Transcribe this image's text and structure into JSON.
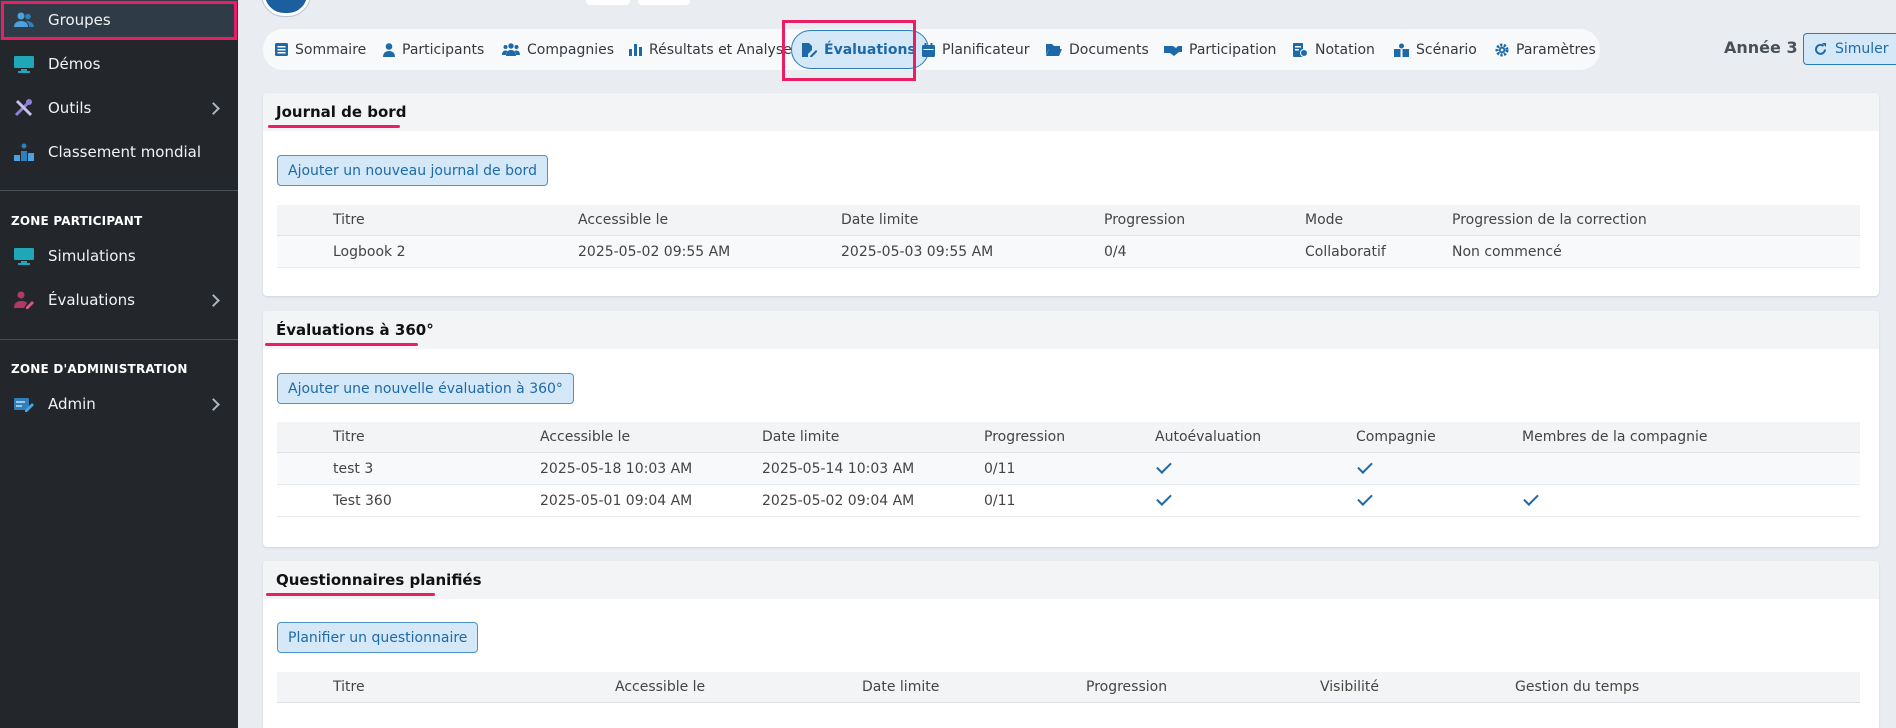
{
  "sidebar": {
    "items": [
      {
        "label": "Groupes"
      },
      {
        "label": "Démos"
      },
      {
        "label": "Outils"
      },
      {
        "label": "Classement mondial"
      },
      {
        "label": "Simulations"
      },
      {
        "label": "Évaluations"
      },
      {
        "label": "Admin"
      }
    ],
    "sections": {
      "participant": "ZONE PARTICIPANT",
      "admin": "ZONE D'ADMINISTRATION"
    }
  },
  "nav": {
    "tabs": [
      {
        "label": "Sommaire",
        "icon": "list-icon"
      },
      {
        "label": "Participants",
        "icon": "user-icon"
      },
      {
        "label": "Compagnies",
        "icon": "users-icon"
      },
      {
        "label": "Résultats et Analyse",
        "icon": "bar-chart-icon"
      },
      {
        "label": "Évaluations",
        "icon": "file-pen-icon"
      },
      {
        "label": "Planificateur",
        "icon": "calendar-icon"
      },
      {
        "label": "Documents",
        "icon": "folder-icon"
      },
      {
        "label": "Participation",
        "icon": "handshake-icon"
      },
      {
        "label": "Notation",
        "icon": "grading-icon"
      },
      {
        "label": "Scénario",
        "icon": "scenario-icon"
      },
      {
        "label": "Paramètres",
        "icon": "gear-icon"
      }
    ],
    "active": "Évaluations",
    "year": "Année 3",
    "simulate_label": "Simuler"
  },
  "logbook": {
    "title": "Journal de bord",
    "add_label": "Ajouter un nouveau journal de bord",
    "columns": [
      "Titre",
      "Accessible le",
      "Date limite",
      "Progression",
      "Mode",
      "Progression de la correction"
    ],
    "rows": [
      [
        "Logbook 2",
        "2025-05-02 09:55 AM",
        "2025-05-03 09:55 AM",
        "0/4",
        "Collaboratif",
        "Non commencé"
      ]
    ]
  },
  "eval360": {
    "title": "Évaluations à 360°",
    "add_label": "Ajouter une nouvelle évaluation à 360°",
    "columns": [
      "Titre",
      "Accessible le",
      "Date limite",
      "Progression",
      "Autoévaluation",
      "Compagnie",
      "Membres de la compagnie"
    ],
    "rows": [
      {
        "title": "test 3",
        "access": "2025-05-18 10:03 AM",
        "deadline": "2025-05-14 10:03 AM",
        "progress": "0/11",
        "self": true,
        "company": true,
        "members": false
      },
      {
        "title": "Test 360",
        "access": "2025-05-01 09:04 AM",
        "deadline": "2025-05-02 09:04 AM",
        "progress": "0/11",
        "self": true,
        "company": true,
        "members": true
      }
    ]
  },
  "questionnaires": {
    "title": "Questionnaires planifiés",
    "add_label": "Planifier un questionnaire",
    "columns": [
      "Titre",
      "Accessible le",
      "Date limite",
      "Progression",
      "Visibilité",
      "Gestion du temps"
    ]
  },
  "colors": {
    "accent": "#1e6aa8",
    "highlight": "#ea1f63",
    "sidebar_bg": "#23272b"
  }
}
